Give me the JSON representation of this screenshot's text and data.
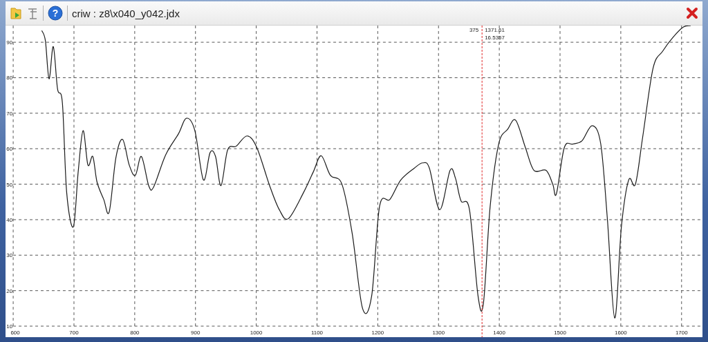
{
  "window": {
    "title": "criw : z8\\x040_y042.jdx"
  },
  "toolbar": {
    "help_glyph": "?"
  },
  "plot": {
    "cursor": {
      "index": "375",
      "x_reading": "1371.61",
      "y_reading": "16.5357"
    },
    "chart_data": {
      "type": "line",
      "grid": true,
      "xlim": [
        600,
        1732
      ],
      "ylim": [
        10,
        94.7
      ],
      "ref_lines": [
        {
          "axis": "x",
          "value": 1371.61,
          "color": "#e02020"
        }
      ],
      "xticks": [
        600,
        700,
        800,
        900,
        1000,
        1100,
        1200,
        1300,
        1400,
        1500,
        1600,
        1700
      ],
      "yticks": [
        10,
        20,
        30,
        40,
        50,
        60,
        70,
        80,
        90
      ],
      "x": [
        647,
        653,
        659,
        666,
        673,
        681,
        688,
        699,
        707,
        715,
        723,
        731,
        738,
        749,
        758,
        769,
        780,
        791,
        801,
        811,
        823,
        831,
        851,
        872,
        885,
        899,
        913,
        924,
        933,
        942,
        953,
        967,
        985,
        1001,
        1022,
        1038,
        1053,
        1078,
        1094,
        1107,
        1122,
        1141,
        1158,
        1175,
        1190,
        1203,
        1220,
        1238,
        1260,
        1274,
        1285,
        1302,
        1319,
        1328,
        1337,
        1351,
        1365,
        1374,
        1385,
        1399,
        1414,
        1427,
        1443,
        1457,
        1477,
        1488,
        1494,
        1507,
        1521,
        1536,
        1553,
        1567,
        1578,
        1590,
        1601,
        1613,
        1624,
        1636,
        1653,
        1669,
        1686,
        1703,
        1715
      ],
      "series": [
        {
          "color": "#1a1a1a",
          "values": [
            93.3,
            90.4,
            79.7,
            88.8,
            76.8,
            72.9,
            47.7,
            38,
            53.5,
            65.1,
            55.4,
            57.8,
            50.6,
            45.7,
            42.2,
            57.4,
            62.6,
            55.4,
            52.5,
            57.8,
            49.6,
            49.2,
            58.3,
            64.2,
            68.6,
            65.1,
            51.2,
            58.9,
            57.8,
            49.6,
            59.7,
            60.7,
            63.6,
            60.3,
            49.6,
            42.8,
            40.3,
            47.7,
            53.5,
            58,
            52.5,
            50,
            36,
            15,
            18.5,
            43.8,
            45.7,
            51.2,
            54.5,
            56,
            54.5,
            42.8,
            53.9,
            51.6,
            45.3,
            42.8,
            18.5,
            16.6,
            43.8,
            61.3,
            65.5,
            68,
            60.3,
            53.9,
            53.9,
            50,
            47.3,
            60.3,
            61.3,
            62.2,
            66.5,
            61.3,
            39.9,
            12.3,
            38,
            51.2,
            50,
            63.2,
            82.6,
            87.5,
            91.4,
            94.3,
            94.7
          ]
        }
      ]
    }
  }
}
